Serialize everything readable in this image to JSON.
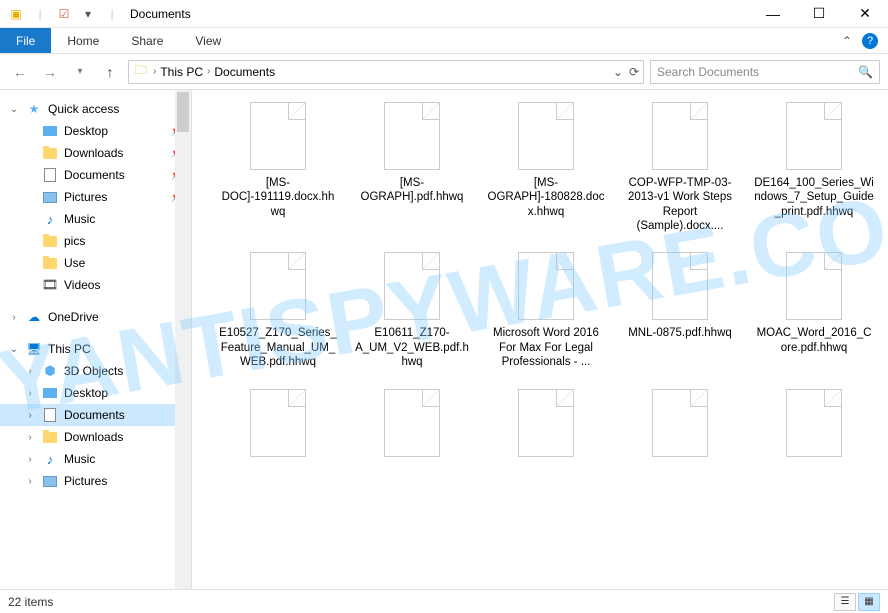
{
  "window": {
    "title": "Documents"
  },
  "ribbon": {
    "file": "File",
    "home": "Home",
    "share": "Share",
    "view": "View"
  },
  "breadcrumb": {
    "root": "This PC",
    "current": "Documents"
  },
  "search": {
    "placeholder": "Search Documents"
  },
  "sidebar": {
    "quickaccess": {
      "label": "Quick access"
    },
    "qa_items": [
      {
        "label": "Desktop",
        "pin": true,
        "icon": "desktop"
      },
      {
        "label": "Downloads",
        "pin": true,
        "icon": "folder"
      },
      {
        "label": "Documents",
        "pin": true,
        "icon": "doc"
      },
      {
        "label": "Pictures",
        "pin": true,
        "icon": "pic"
      },
      {
        "label": "Music",
        "pin": false,
        "icon": "music"
      },
      {
        "label": "pics",
        "pin": false,
        "icon": "folder"
      },
      {
        "label": "Use",
        "pin": false,
        "icon": "folder"
      },
      {
        "label": "Videos",
        "pin": false,
        "icon": "video"
      }
    ],
    "onedrive": {
      "label": "OneDrive"
    },
    "thispc": {
      "label": "This PC"
    },
    "pc_items": [
      {
        "label": "3D Objects",
        "icon": "3d"
      },
      {
        "label": "Desktop",
        "icon": "desktop"
      },
      {
        "label": "Documents",
        "icon": "doc",
        "selected": true
      },
      {
        "label": "Downloads",
        "icon": "folder"
      },
      {
        "label": "Music",
        "icon": "music"
      },
      {
        "label": "Pictures",
        "icon": "pic"
      }
    ]
  },
  "files": [
    {
      "name": "[MS-DOC]-191119.docx.hhwq"
    },
    {
      "name": "[MS-OGRAPH].pdf.hhwq"
    },
    {
      "name": "[MS-OGRAPH]-180828.docx.hhwq"
    },
    {
      "name": "COP-WFP-TMP-03-2013-v1 Work Steps Report (Sample).docx...."
    },
    {
      "name": "DE164_100_Series_Windows_7_Setup_Guide_print.pdf.hhwq"
    },
    {
      "name": "E10527_Z170_Series_Feature_Manual_UM_WEB.pdf.hhwq"
    },
    {
      "name": "E10611_Z170-A_UM_V2_WEB.pdf.hhwq"
    },
    {
      "name": "Microsoft Word 2016 For Max For Legal Professionals - ..."
    },
    {
      "name": "MNL-0875.pdf.hhwq"
    },
    {
      "name": "MOAC_Word_2016_Core.pdf.hhwq"
    },
    {
      "name": ""
    },
    {
      "name": ""
    },
    {
      "name": ""
    },
    {
      "name": ""
    },
    {
      "name": ""
    }
  ],
  "status": {
    "count": "22 items"
  },
  "watermark": "MYANTISPYWARE.COM"
}
